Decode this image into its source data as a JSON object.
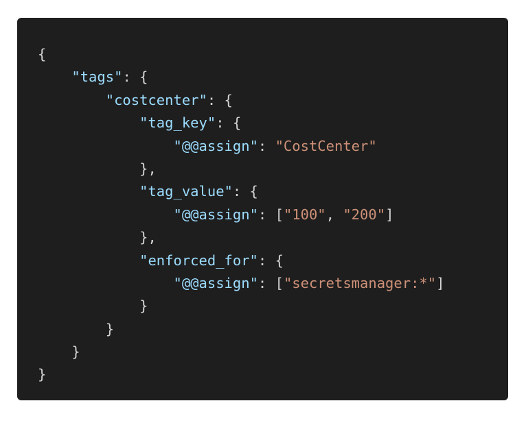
{
  "code_panel": {
    "language": "json",
    "colors": {
      "background": "#1e1e1e",
      "key": "#9cdcfe",
      "string": "#ce9178",
      "punctuation": "#d4d4d4"
    },
    "lines": [
      [
        {
          "t": "p",
          "v": "{"
        }
      ],
      [
        {
          "t": "p",
          "v": "    "
        },
        {
          "t": "k",
          "v": "\"tags\""
        },
        {
          "t": "p",
          "v": ": {"
        }
      ],
      [
        {
          "t": "p",
          "v": "        "
        },
        {
          "t": "k",
          "v": "\"costcenter\""
        },
        {
          "t": "p",
          "v": ": {"
        }
      ],
      [
        {
          "t": "p",
          "v": "            "
        },
        {
          "t": "k",
          "v": "\"tag_key\""
        },
        {
          "t": "p",
          "v": ": {"
        }
      ],
      [
        {
          "t": "p",
          "v": "                "
        },
        {
          "t": "k",
          "v": "\"@@assign\""
        },
        {
          "t": "p",
          "v": ": "
        },
        {
          "t": "s",
          "v": "\"CostCenter\""
        }
      ],
      [
        {
          "t": "p",
          "v": "            },"
        }
      ],
      [
        {
          "t": "p",
          "v": "            "
        },
        {
          "t": "k",
          "v": "\"tag_value\""
        },
        {
          "t": "p",
          "v": ": {"
        }
      ],
      [
        {
          "t": "p",
          "v": "                "
        },
        {
          "t": "k",
          "v": "\"@@assign\""
        },
        {
          "t": "p",
          "v": ": ["
        },
        {
          "t": "s",
          "v": "\"100\""
        },
        {
          "t": "p",
          "v": ", "
        },
        {
          "t": "s",
          "v": "\"200\""
        },
        {
          "t": "p",
          "v": "]"
        }
      ],
      [
        {
          "t": "p",
          "v": "            },"
        }
      ],
      [
        {
          "t": "p",
          "v": "            "
        },
        {
          "t": "k",
          "v": "\"enforced_for\""
        },
        {
          "t": "p",
          "v": ": {"
        }
      ],
      [
        {
          "t": "p",
          "v": "                "
        },
        {
          "t": "k",
          "v": "\"@@assign\""
        },
        {
          "t": "p",
          "v": ": ["
        },
        {
          "t": "s",
          "v": "\"secretsmanager:*\""
        },
        {
          "t": "p",
          "v": "]"
        }
      ],
      [
        {
          "t": "p",
          "v": "            }"
        }
      ],
      [
        {
          "t": "p",
          "v": "        }"
        }
      ],
      [
        {
          "t": "p",
          "v": "    }"
        }
      ],
      [
        {
          "t": "p",
          "v": "}"
        }
      ]
    ]
  }
}
